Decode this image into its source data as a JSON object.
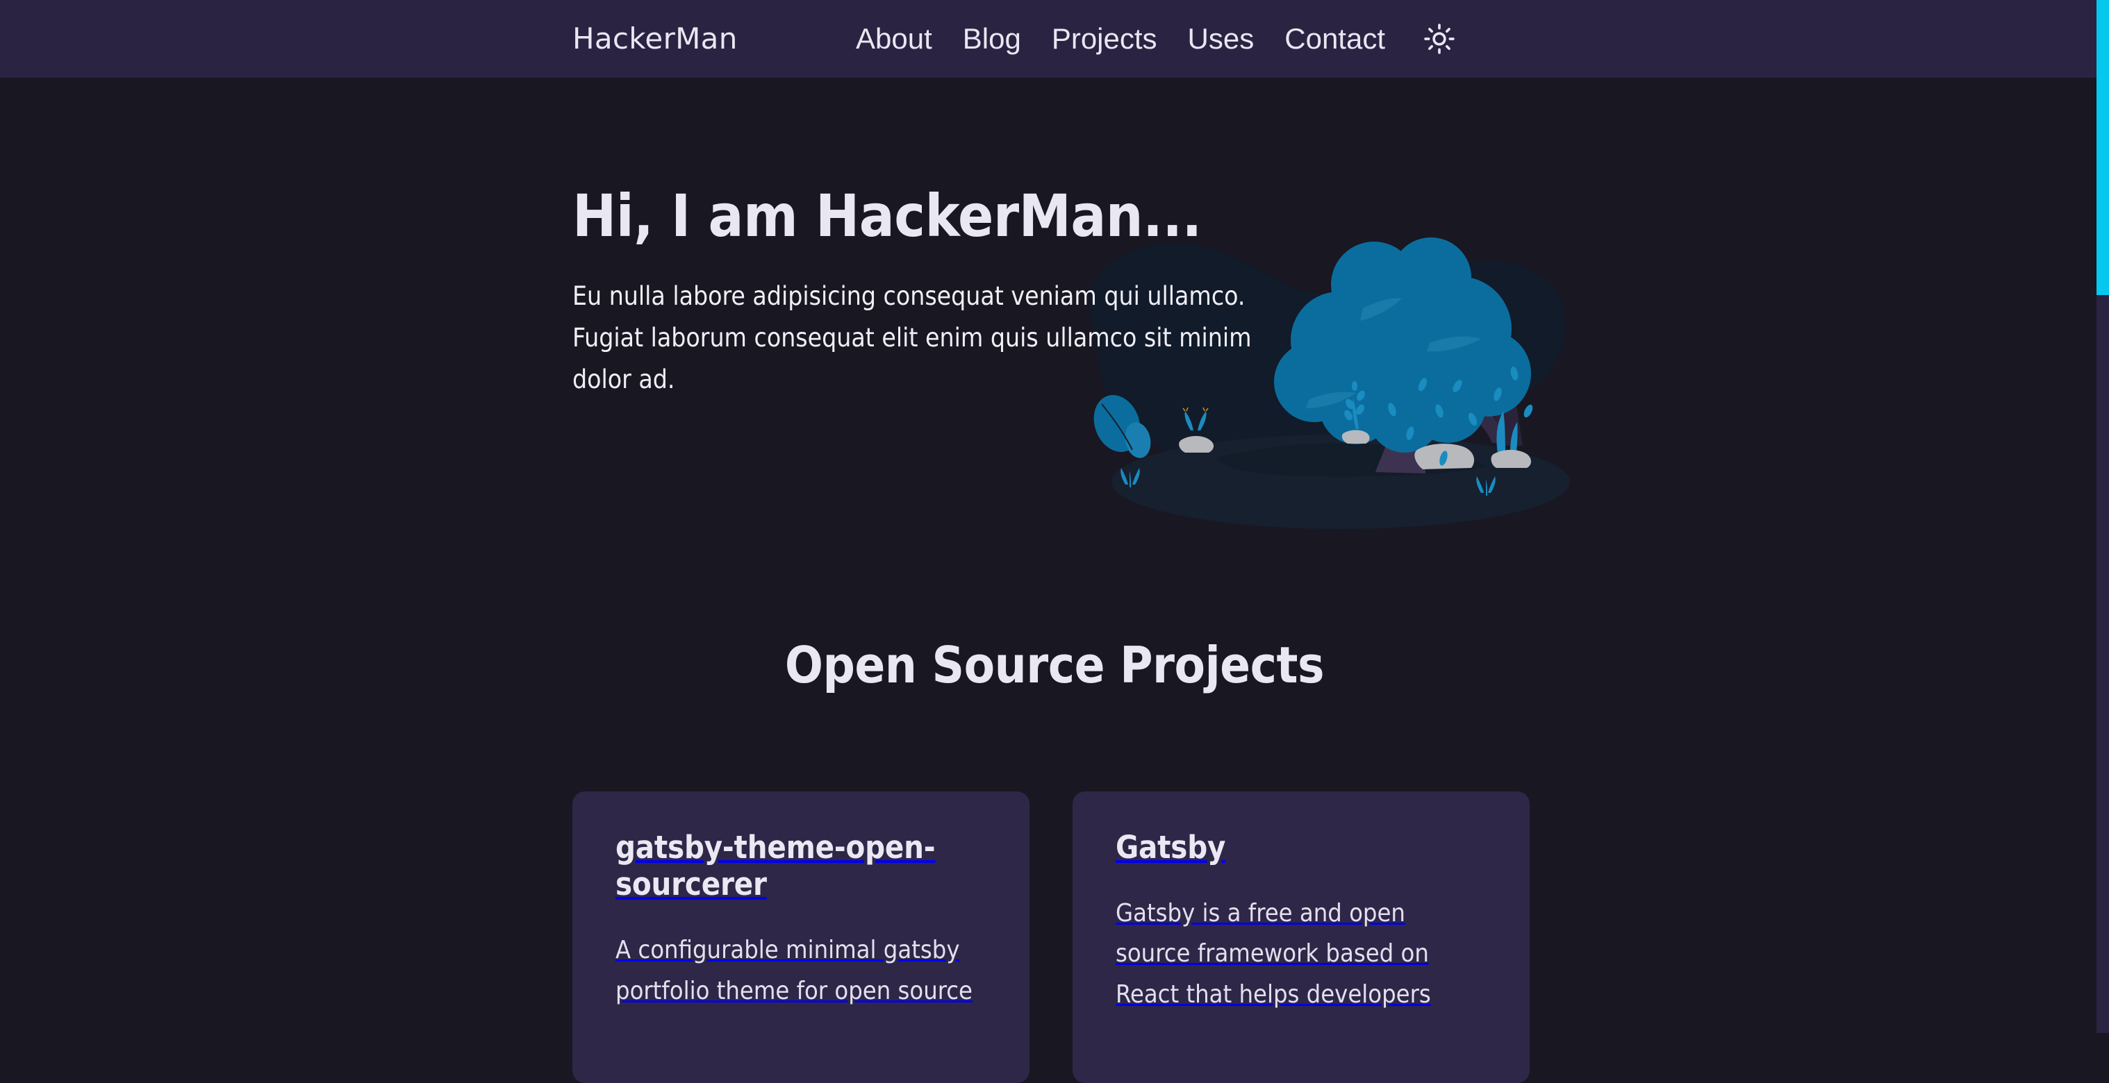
{
  "theme": {
    "header_bg": "#2a2342",
    "page_bg": "#191722",
    "card_bg": "#2e2747",
    "text_primary": "#e9e7f2",
    "accent_cyan": "#06c8ee",
    "tree_leaf": "#0b6d9e",
    "tree_trunk": "#3d3350",
    "rock": "#b7b9bd"
  },
  "header": {
    "brand": "HackerMan",
    "nav": [
      {
        "label": "About"
      },
      {
        "label": "Blog"
      },
      {
        "label": "Projects"
      },
      {
        "label": "Uses"
      },
      {
        "label": "Contact"
      }
    ],
    "theme_toggle_icon": "sun-icon"
  },
  "hero": {
    "title": "Hi, I am HackerMan...",
    "paragraph": "Eu nulla labore adipisicing consequat veniam qui ullamco. Fugiat laborum consequat elit enim quis ullamco sit minim dolor ad.",
    "illustration": "tree-night-scene-illustration"
  },
  "projects": {
    "section_title": "Open Source Projects",
    "cards": [
      {
        "title": "gatsby-theme-open-sourcerer",
        "description": "A configurable minimal gatsby portfolio theme for open source"
      },
      {
        "title": "Gatsby",
        "description": "Gatsby is a free and open source framework based on React that helps developers"
      }
    ]
  },
  "scrollbar": {
    "thumb_color": "#06c8ee",
    "track_color": "#2a2342"
  }
}
